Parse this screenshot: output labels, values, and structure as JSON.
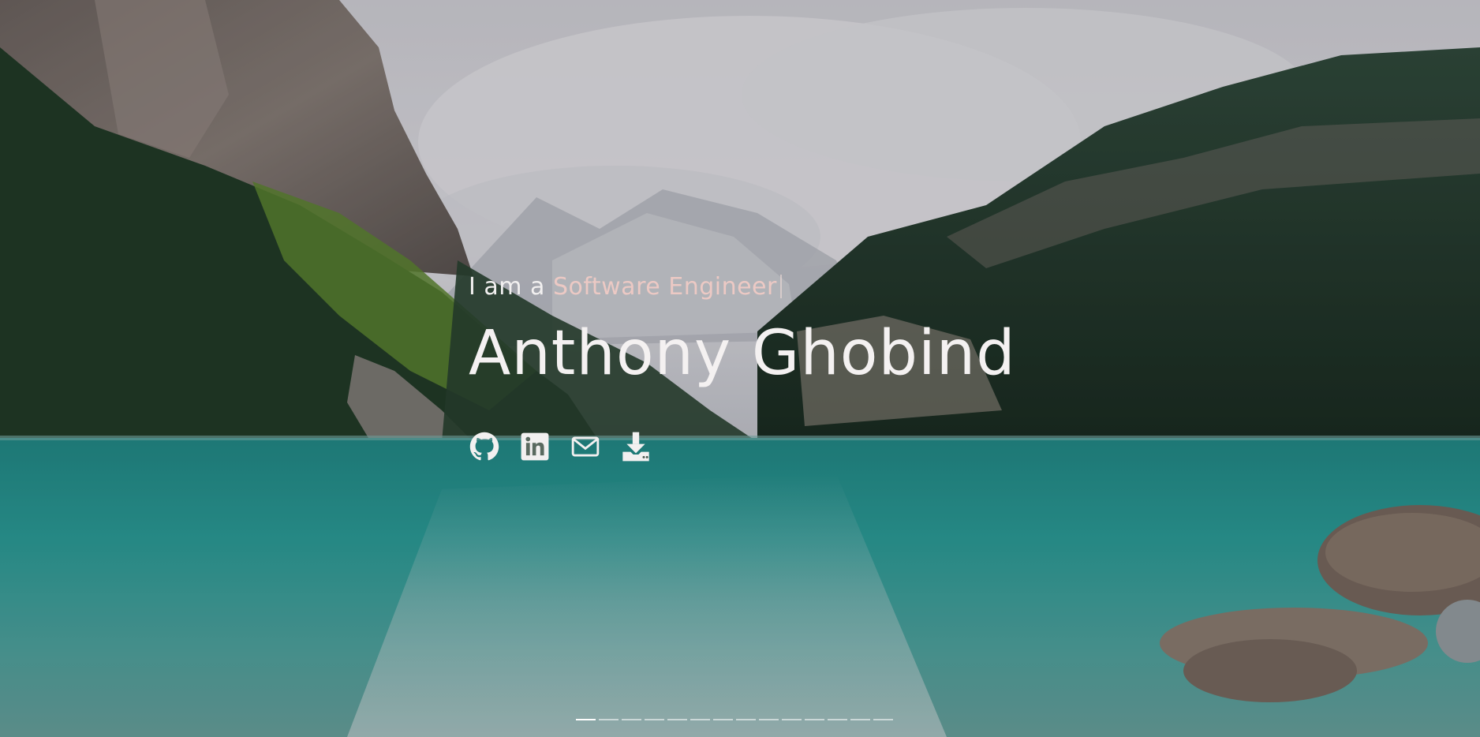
{
  "hero": {
    "tagline_prefix": "I am a ",
    "tagline_role": "Software Engineer",
    "name": "Anthony Ghobind"
  },
  "social_links": [
    {
      "icon": "github-icon"
    },
    {
      "icon": "linkedin-icon"
    },
    {
      "icon": "envelope-icon"
    },
    {
      "icon": "download-icon"
    }
  ],
  "carousel": {
    "indicator_count": 14,
    "active_index": 0
  },
  "colors": {
    "name_text": "#f4f1f1",
    "role_text": "#ecc9c4",
    "lake": "#2aa7a0",
    "forest": "#1c3324",
    "sky": "#e6e6ea"
  }
}
